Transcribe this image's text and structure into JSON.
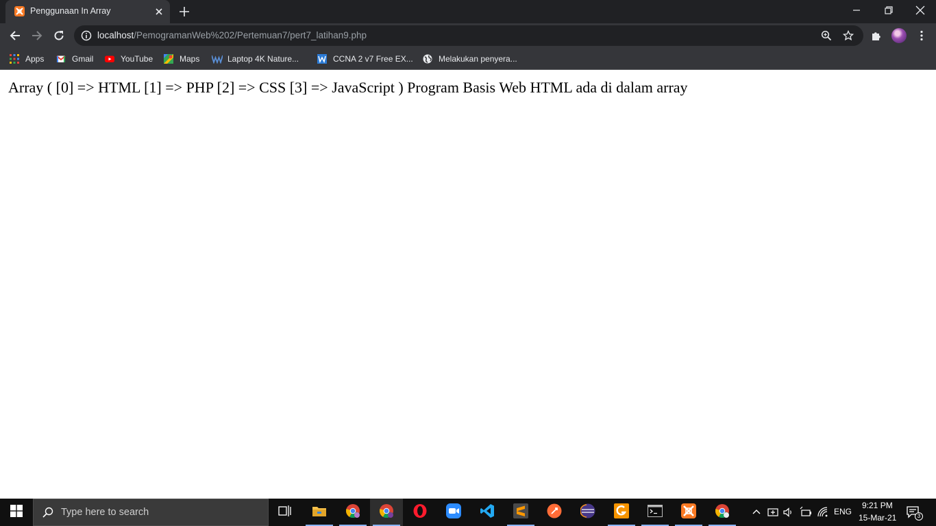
{
  "browser": {
    "tab": {
      "title": "Penggunaan In Array",
      "favicon": "xampp-icon"
    },
    "url": {
      "host": "localhost",
      "path": "/PemogramanWeb%202/Pertemuan7/pert7_latihan9.php"
    },
    "bookmarks": [
      {
        "label": "Apps",
        "icon": "apps-grid-icon"
      },
      {
        "label": "Gmail",
        "icon": "gmail-icon"
      },
      {
        "label": "YouTube",
        "icon": "youtube-icon"
      },
      {
        "label": "Maps",
        "icon": "maps-icon"
      },
      {
        "label": "Laptop 4K Nature...",
        "icon": "wallpaper-site-icon"
      },
      {
        "label": "CCNA 2 v7 Free EX...",
        "icon": "w-site-icon"
      },
      {
        "label": "Melakukan penyera...",
        "icon": "globe-icon"
      }
    ]
  },
  "page": {
    "output": "Array ( [0] => HTML [1] => PHP [2] => CSS [3] => JavaScript ) Program Basis Web HTML ada di dalam array"
  },
  "taskbar": {
    "search_placeholder": "Type here to search",
    "lang": "ENG",
    "time": "9:21 PM",
    "date": "15-Mar-21",
    "notification_count": "3",
    "apps": [
      "task-view",
      "file-explorer",
      "chrome",
      "chrome-profile",
      "opera",
      "zoom",
      "vscode",
      "sublime-text",
      "postman",
      "eclipse",
      "git-extensions",
      "terminal",
      "xampp",
      "chrome-alt"
    ]
  },
  "colors": {
    "tab_strip": "#202124",
    "toolbar": "#35363a",
    "taskbar": "#101010",
    "accent": "#8ab4f8"
  }
}
